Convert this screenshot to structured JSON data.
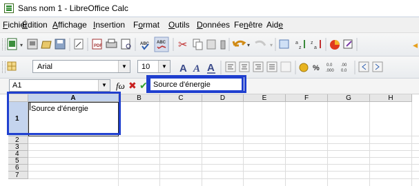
{
  "window": {
    "title": "Sans nom 1 - LibreOffice Calc"
  },
  "menu": [
    {
      "pre": "",
      "u": "F",
      "post": "ichier",
      "name": "menu-fichier"
    },
    {
      "pre": "",
      "u": "É",
      "post": "dition",
      "name": "menu-edition"
    },
    {
      "pre": "",
      "u": "A",
      "post": "ffichage",
      "name": "menu-affichage"
    },
    {
      "pre": "",
      "u": "I",
      "post": "nsertion",
      "name": "menu-insertion"
    },
    {
      "pre": "F",
      "u": "o",
      "post": "rmat",
      "name": "menu-format"
    },
    {
      "pre": "",
      "u": "O",
      "post": "utils",
      "name": "menu-outils"
    },
    {
      "pre": "",
      "u": "D",
      "post": "onnées",
      "name": "menu-donnees"
    },
    {
      "pre": "Fe",
      "u": "n",
      "post": "être",
      "name": "menu-fenetre"
    },
    {
      "pre": "Aid",
      "u": "e",
      "post": "",
      "name": "menu-aide"
    }
  ],
  "formatting": {
    "font_name": "Arial",
    "font_size": "10"
  },
  "formula_bar": {
    "cell_ref": "A1",
    "function_symbol": "fω",
    "cancel_symbol": "✖",
    "accept_symbol": "✔",
    "content": "Source d'énergie"
  },
  "sheet": {
    "columns": [
      "A",
      "B",
      "C",
      "D",
      "E",
      "F",
      "G",
      "H"
    ],
    "rows": [
      "1",
      "2",
      "3",
      "4",
      "5",
      "6",
      "7"
    ],
    "active_cell_text": "Source d'énergie"
  },
  "colors": {
    "highlight": "#1f3fcf",
    "header_bg": "#e6e6e6",
    "active_header_bg": "#c4d4ee"
  }
}
